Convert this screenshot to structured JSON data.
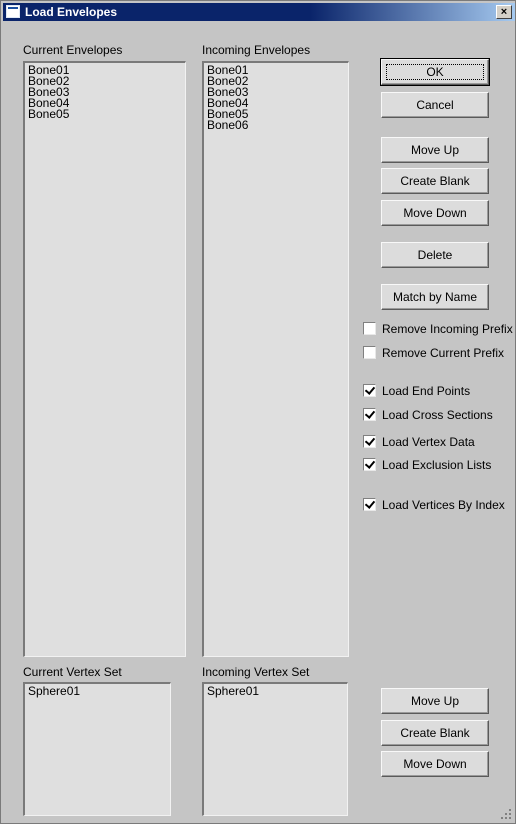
{
  "window": {
    "title": "Load Envelopes",
    "close_label": "×"
  },
  "current_envelopes": {
    "label": "Current Envelopes",
    "items": [
      "Bone01",
      "Bone02",
      "Bone03",
      "Bone04",
      "Bone05"
    ]
  },
  "incoming_envelopes": {
    "label": "Incoming Envelopes",
    "items": [
      "Bone01",
      "Bone02",
      "Bone03",
      "Bone04",
      "Bone05",
      "Bone06"
    ]
  },
  "current_vertex_set": {
    "label": "Current Vertex Set",
    "items": [
      "Sphere01"
    ]
  },
  "incoming_vertex_set": {
    "label": "Incoming Vertex Set",
    "items": [
      "Sphere01"
    ]
  },
  "buttons": {
    "ok": "OK",
    "cancel": "Cancel",
    "move_up": "Move Up",
    "create_blank": "Create Blank",
    "move_down": "Move Down",
    "delete": "Delete",
    "match_by_name": "Match by Name",
    "vs_move_up": "Move Up",
    "vs_create_blank": "Create Blank",
    "vs_move_down": "Move Down"
  },
  "options": {
    "remove_incoming_prefix": {
      "label": "Remove Incoming Prefix",
      "checked": false
    },
    "remove_current_prefix": {
      "label": "Remove Current Prefix",
      "checked": false
    },
    "load_end_points": {
      "label": "Load End Points",
      "checked": true
    },
    "load_cross_sections": {
      "label": "Load Cross Sections",
      "checked": true
    },
    "load_vertex_data": {
      "label": "Load Vertex Data",
      "checked": true
    },
    "load_exclusion_lists": {
      "label": "Load Exclusion Lists",
      "checked": true
    },
    "load_vertices_by_index": {
      "label": "Load Vertices By Index",
      "checked": true
    }
  }
}
